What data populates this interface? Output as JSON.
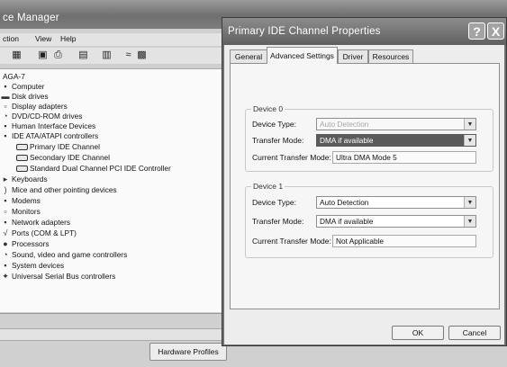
{
  "device_manager": {
    "title": "ce Manager",
    "menu": [
      "ction",
      "View",
      "Help"
    ],
    "toolbar_icons": [
      "properties-icon",
      "update-driver-icon",
      "print-icon",
      "help-icon",
      "scan-hardware-icon",
      "uninstall-icon",
      "disable-icon"
    ],
    "tree": [
      {
        "label": "AGA-7",
        "icon": "computer-root-icon"
      },
      {
        "label": "Computer",
        "icon": "computer-icon"
      },
      {
        "label": "Disk drives",
        "icon": "disk-drive-icon"
      },
      {
        "label": "Display adapters",
        "icon": "display-adapter-icon"
      },
      {
        "label": "DVD/CD-ROM drives",
        "icon": "dvd-drive-icon"
      },
      {
        "label": "Human Interface Devices",
        "icon": "hid-icon"
      },
      {
        "label": "IDE ATA/ATAPI controllers",
        "icon": "ide-controller-icon"
      },
      {
        "label": "Primary IDE Channel",
        "icon": "ide-channel-icon"
      },
      {
        "label": "Secondary IDE Channel",
        "icon": "ide-channel-icon"
      },
      {
        "label": "Standard Dual Channel PCI IDE Controller",
        "icon": "ide-channel-icon"
      },
      {
        "label": "Keyboards",
        "icon": "keyboard-icon"
      },
      {
        "label": "Mice and other pointing devices",
        "icon": "mouse-icon"
      },
      {
        "label": "Modems",
        "icon": "modem-icon"
      },
      {
        "label": "Monitors",
        "icon": "monitor-icon"
      },
      {
        "label": "Network adapters",
        "icon": "network-adapter-icon"
      },
      {
        "label": "Ports (COM & LPT)",
        "icon": "port-icon"
      },
      {
        "label": "Processors",
        "icon": "processor-icon"
      },
      {
        "label": "Sound, video and game controllers",
        "icon": "sound-icon"
      },
      {
        "label": "System devices",
        "icon": "system-device-icon"
      },
      {
        "label": "Universal Serial Bus controllers",
        "icon": "usb-icon"
      }
    ],
    "hardware_profiles_label": "Hardware Profiles"
  },
  "dialog": {
    "title": "Primary IDE Channel Properties",
    "help_label": "?",
    "close_label": "X",
    "tabs": [
      "General",
      "Advanced Settings",
      "Driver",
      "Resources"
    ],
    "active_tab": "Advanced Settings",
    "device0": {
      "legend": "Device 0",
      "device_type_label": "Device Type:",
      "device_type_value": "Auto Detection",
      "transfer_mode_label": "Transfer Mode:",
      "transfer_mode_value": "DMA if available",
      "current_mode_label": "Current Transfer Mode:",
      "current_mode_value": "Ultra DMA Mode 5"
    },
    "device1": {
      "legend": "Device 1",
      "device_type_label": "Device Type:",
      "device_type_value": "Auto Detection",
      "transfer_mode_label": "Transfer Mode:",
      "transfer_mode_value": "DMA if available",
      "current_mode_label": "Current Transfer Mode:",
      "current_mode_value": "Not Applicable"
    },
    "ok_label": "OK",
    "cancel_label": "Cancel"
  },
  "colors": {
    "titlebar": "#6f6f6f",
    "selection": "#5a5a5a",
    "dialog_face": "#ededed"
  }
}
